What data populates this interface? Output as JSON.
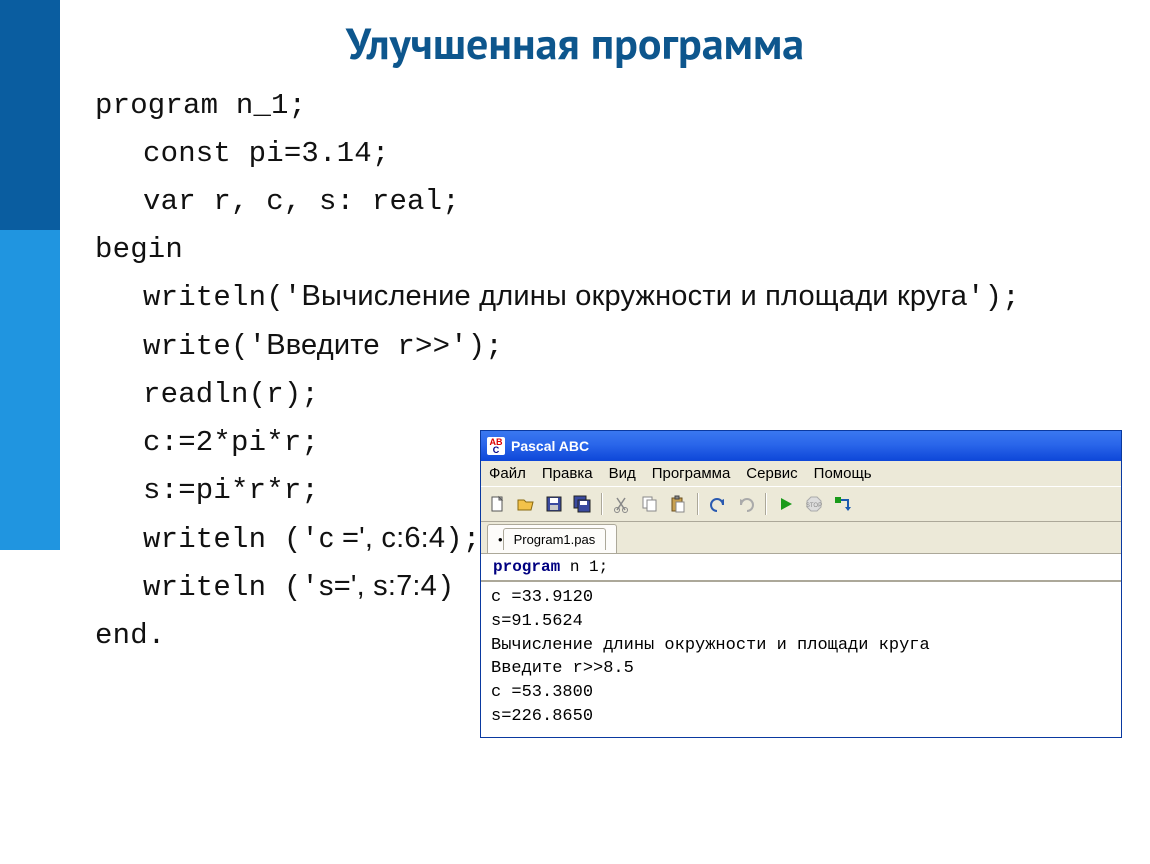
{
  "title": "Улучшенная программа",
  "code": {
    "l1a": "program",
    "l1b": " n_1;",
    "l2a": "const",
    "l2b": " pi=3.14;",
    "l3a": "var",
    "l3b": " r, c, s: real;",
    "l4": "begin",
    "l5a": "writeln('",
    "l5b": "Вычисление длины окружности и площади круга",
    "l5c": "');",
    "l6a": "write('",
    "l6b": "Введите",
    "l6c": " r>>');",
    "l7": "readln(r);",
    "l8": "c:=2*pi*r;",
    "l9": "s:=pi*r*r;",
    "l10a": "writeln ('",
    "l10b": "c =', c:6:4",
    "l10c": ");",
    "l11a": "writeln ('",
    "l11b": "s=', s:7:4",
    "l11c": ")",
    "l12": "end."
  },
  "ide": {
    "title": "Pascal ABC",
    "menu": [
      "Файл",
      "Правка",
      "Вид",
      "Программа",
      "Сервис",
      "Помощь"
    ],
    "tab": "Program1.pas",
    "editor_kw": "program",
    "editor_rest": " n 1;",
    "output": [
      "c =33.9120",
      "s=91.5624",
      "Вычисление длины окружности и площади круга",
      "Введите r>>8.5",
      "c =53.3800",
      "s=226.8650"
    ]
  }
}
